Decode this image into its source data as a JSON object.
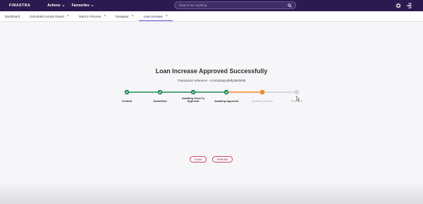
{
  "header": {
    "brand": "FINASTRA",
    "nav": [
      "Actions",
      "Favourites"
    ],
    "search_placeholder": "Search for Anything"
  },
  "tabs": [
    {
      "label": "Dashboard",
      "closable": false,
      "active": false
    },
    {
      "label": "Scheduled Activity Report",
      "closable": true,
      "active": false
    },
    {
      "label": "Work In Process",
      "closable": true,
      "active": false
    },
    {
      "label": "Navigator",
      "closable": true,
      "active": false
    },
    {
      "label": "Loan Increase",
      "closable": true,
      "active": true
    }
  ],
  "main": {
    "title": "Loan Increase Approved Successfully",
    "reference": "Transaction reference - ccn44rt5xjryd9tfy3800008"
  },
  "steps": [
    {
      "label": "Created",
      "status": "done"
    },
    {
      "label": "Submitted",
      "status": "done"
    },
    {
      "label": "Awaiting Send To Approval",
      "status": "done"
    },
    {
      "label": "Awaiting Approval",
      "status": "done"
    },
    {
      "label": "Awaiting Release",
      "status": "current"
    },
    {
      "label": "Released",
      "status": "pending"
    }
  ],
  "buttons": {
    "close": "Close",
    "release": "Release"
  },
  "colors": {
    "header_bg": "#2b1a4f",
    "done": "#1e8a5a",
    "current": "#f08a24",
    "pending": "#c9c9c9",
    "button_border": "#c44264"
  }
}
